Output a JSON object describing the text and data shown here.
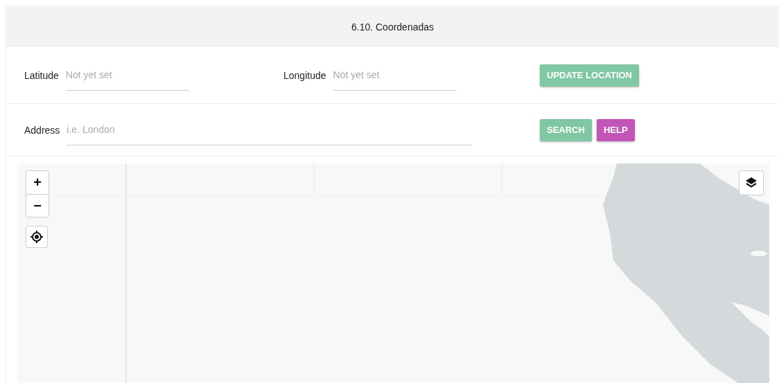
{
  "panel": {
    "title": "6.10. Coordenadas"
  },
  "coordinates": [
    {
      "label": "Latitude",
      "placeholder": "Not yet set"
    },
    {
      "label": "Longitude",
      "placeholder": "Not yet set"
    }
  ],
  "update_button": "UPDATE LOCATION",
  "address": {
    "label": "Address",
    "placeholder": "i.e. London"
  },
  "buttons": [
    {
      "label": "SEARCH",
      "color": "#80c7a3"
    },
    {
      "label": "HELP",
      "color": "#c355b9"
    }
  ],
  "map": {
    "zoom_in": "+",
    "zoom_out": "−"
  }
}
